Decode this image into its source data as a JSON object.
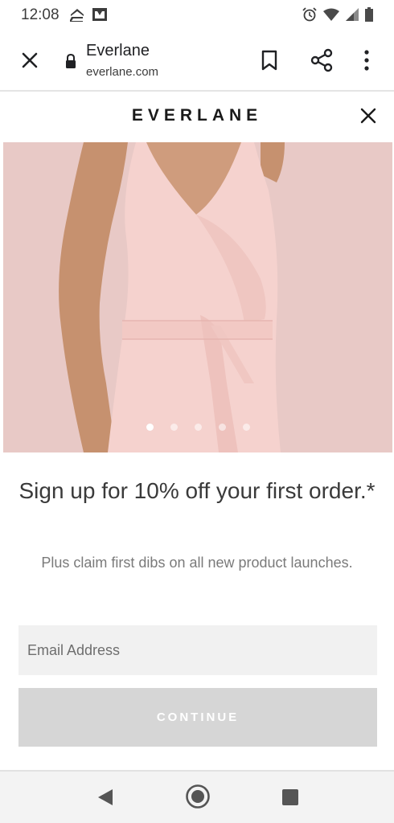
{
  "status_bar": {
    "time": "12:08",
    "icons": [
      "app-notification-icon",
      "gallery-notification-icon",
      "alarm-icon",
      "wifi-icon",
      "signal-icon",
      "battery-icon"
    ]
  },
  "browser": {
    "title": "Everlane",
    "url": "everlane.com",
    "icons": [
      "close-icon",
      "lock-icon",
      "bookmark-icon",
      "share-icon",
      "more-vert-icon"
    ]
  },
  "modal": {
    "brand": "EVERLANE",
    "close_icon": "close-icon",
    "carousel": {
      "count": 5,
      "active_index": 0
    },
    "headline": "Sign up for 10% off your first order.*",
    "subtext": "Plus claim first dibs on all new product launches.",
    "email_placeholder": "Email Address",
    "continue_label": "CONTINUE"
  },
  "nav": {
    "icons": [
      "back-icon",
      "home-icon",
      "recents-icon"
    ]
  },
  "colors": {
    "hero_background": "#e8c9c6",
    "dress": "#f6d3cf",
    "button_disabled": "#d6d6d6",
    "input_background": "#f1f1f1"
  }
}
